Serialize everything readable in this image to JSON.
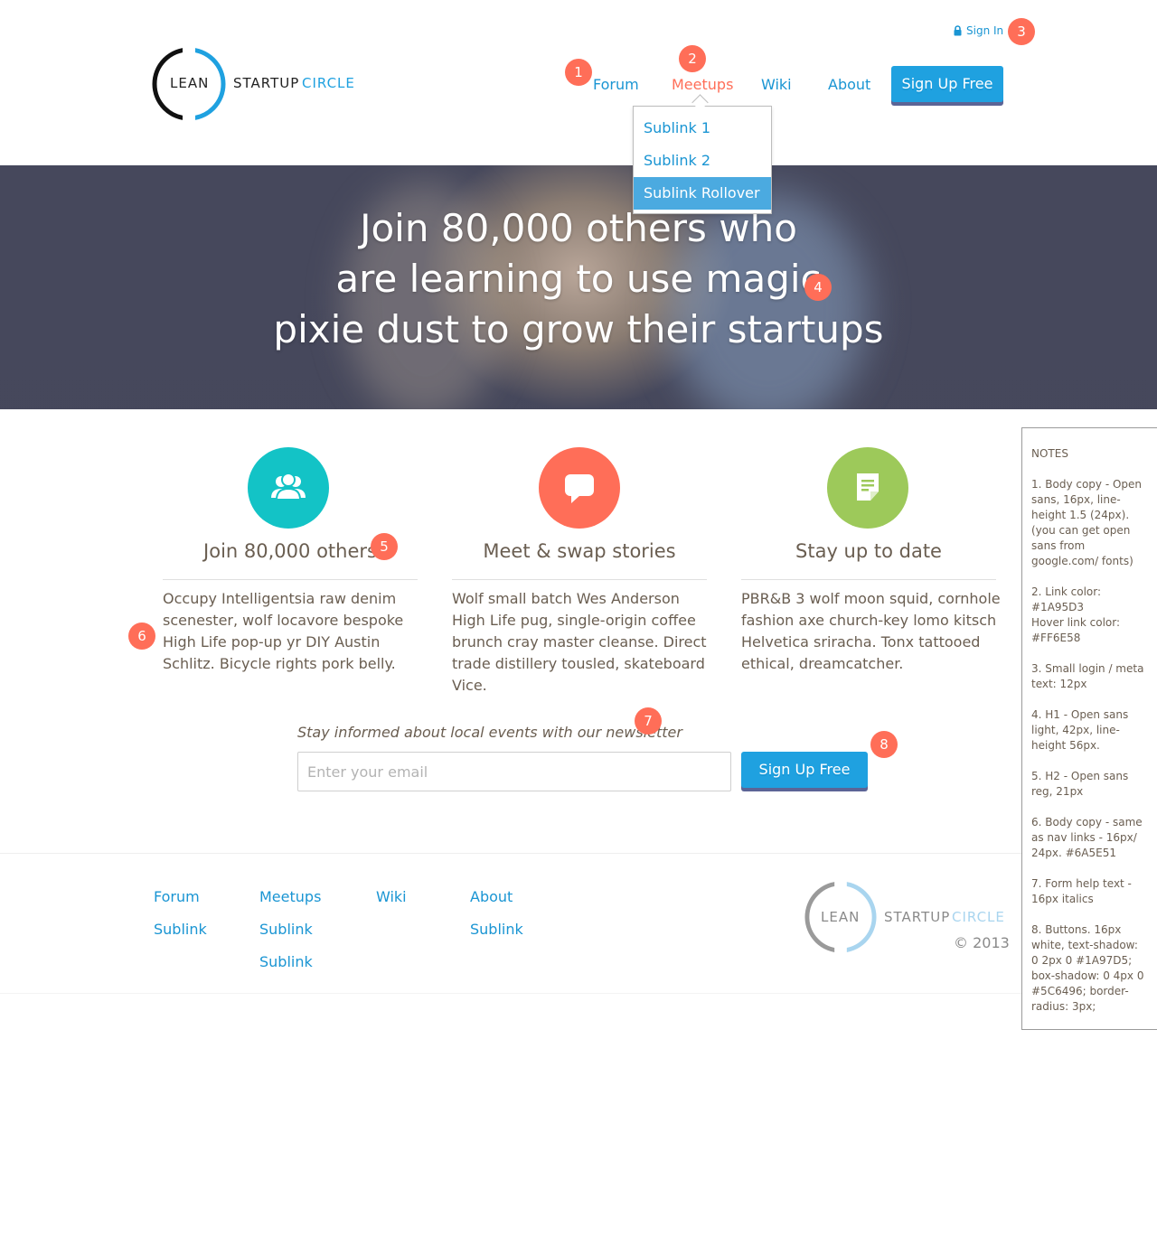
{
  "brand": {
    "lean": "LEAN",
    "startup": "STARTUP",
    "circle": "CIRCLE"
  },
  "header": {
    "signin_label": "Sign In",
    "nav": [
      "Forum",
      "Meetups",
      "Wiki",
      "About"
    ],
    "signup_label": "Sign Up Free",
    "dropdown": [
      "Sublink 1",
      "Sublink 2",
      "Sublink Rollover"
    ]
  },
  "hero": {
    "headline_1": "Join 80,000 others who",
    "headline_2": "are learning to use magic",
    "headline_3": "pixie dust to grow their startups"
  },
  "features": [
    {
      "title": "Join 80,000 others",
      "body": "Occupy Intelligentsia raw denim scenester, wolf locavore bespoke High Life pop-up yr DIY Austin Schlitz. Bicycle rights pork belly.",
      "icon": "users-icon",
      "color": "#13C3C6"
    },
    {
      "title": "Meet & swap stories",
      "body": "Wolf small batch Wes Anderson High Life pug, single-origin coffee brunch cray master cleanse. Direct trade distillery tousled, skateboard Vice.",
      "icon": "speech-bubble-icon",
      "color": "#FF6E58"
    },
    {
      "title": "Stay up to date",
      "body": "PBR&B 3 wolf moon squid, cornhole fashion axe church-key lomo kitsch Helvetica sriracha. Tonx tattooed ethical, dreamcatcher.",
      "icon": "document-icon",
      "color": "#9DC95A"
    }
  ],
  "newsletter": {
    "help_text": "Stay informed about local events with our newsletter",
    "placeholder": "Enter your email",
    "button_label": "Sign Up Free"
  },
  "footer": {
    "columns": [
      {
        "title": "Forum",
        "links": [
          "Sublink"
        ]
      },
      {
        "title": "Meetups",
        "links": [
          "Sublink",
          "Sublink"
        ]
      },
      {
        "title": "Wiki",
        "links": []
      },
      {
        "title": "About",
        "links": [
          "Sublink"
        ]
      }
    ],
    "copyright": "© 2013"
  },
  "markers": [
    "1",
    "2",
    "3",
    "4",
    "5",
    "6",
    "7",
    "8"
  ],
  "notes": {
    "title": "NOTES",
    "items": [
      "1. Body copy - Open sans, 16px, line-height 1.5 (24px). (you can get open sans from google.com/ fonts)",
      "2. Link color: #1A95D3\nHover link color: #FF6E58",
      "3. Small login / meta text: 12px",
      "4. H1 - Open sans light, 42px, line-height 56px.",
      "5. H2 - Open sans reg, 21px",
      "6. Body copy - same as nav links - 16px/ 24px. #6A5E51",
      "7. Form help text - 16px italics",
      "8. Buttons. 16px white, text-shadow: 0 2px 0 #1A97D5; box-shadow: 0 4px 0 #5C6496; border-radius: 3px;"
    ]
  },
  "colors": {
    "link": "#1A95D3",
    "hover": "#FF6E58",
    "body": "#6A5E51",
    "button": "#1FA1E0",
    "button_shadow": "#5C6496"
  }
}
